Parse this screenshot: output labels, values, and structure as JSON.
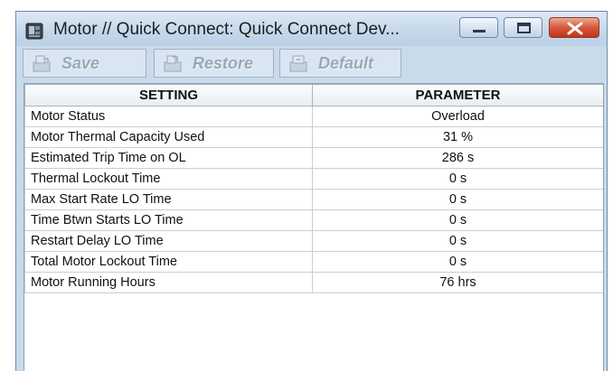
{
  "window": {
    "title": "Motor // Quick Connect: Quick Connect Dev..."
  },
  "toolbar": {
    "save_label": "Save",
    "restore_label": "Restore",
    "default_label": "Default"
  },
  "table": {
    "headers": [
      "SETTING",
      "PARAMETER"
    ],
    "rows": [
      {
        "setting": "Motor Status",
        "parameter": "Overload"
      },
      {
        "setting": "Motor Thermal Capacity Used",
        "parameter": "31 %"
      },
      {
        "setting": "Estimated Trip Time on OL",
        "parameter": "286 s"
      },
      {
        "setting": "Thermal Lockout Time",
        "parameter": "0 s"
      },
      {
        "setting": "Max Start Rate LO Time",
        "parameter": "0 s"
      },
      {
        "setting": "Time Btwn Starts LO Time",
        "parameter": "0 s"
      },
      {
        "setting": "Restart Delay LO Time",
        "parameter": "0 s"
      },
      {
        "setting": "Total Motor Lockout Time",
        "parameter": "0 s"
      },
      {
        "setting": "Motor Running Hours",
        "parameter": "76 hrs"
      }
    ]
  },
  "colors": {
    "window_frame": "#c9dbea",
    "close_button": "#d9583c",
    "disabled_text": "#9aa9b6"
  }
}
